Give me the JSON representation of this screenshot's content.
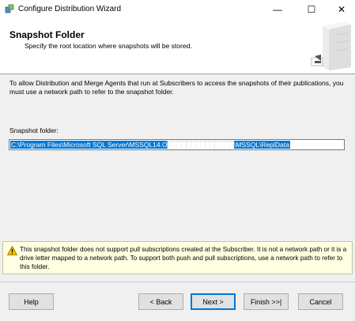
{
  "window": {
    "title": "Configure Distribution Wizard",
    "minimize": "—",
    "maximize": "☐",
    "close": "✕"
  },
  "header": {
    "title": "Snapshot Folder",
    "subtitle": "Specify the root location where snapshots will be stored."
  },
  "intro_text": "To allow Distribution and Merge Agents that run at Subscribers to access the snapshots of their publications, you must use a network path to refer to the snapshot folder.",
  "snapshot_folder": {
    "label": "Snapshot folder:",
    "value": "C:\\Program Files\\Microsoft SQL Server\\MSSQL14.O██████████████\\MSSQL\\ReplData"
  },
  "warning": {
    "icon": "warning-triangle-icon",
    "text": "This snapshot folder does not support pull subscriptions created at the Subscriber. It is not a network path or it is a drive letter mapped to a network path. To support both push and pull subscriptions, use a network path to refer to this folder."
  },
  "buttons": {
    "help": "Help",
    "back": "< Back",
    "next": "Next >",
    "finish": "Finish >>|",
    "cancel": "Cancel"
  },
  "colors": {
    "selection": "#0078d7",
    "warning_background": "#ffffe1",
    "dialog_background": "#f0f0f0"
  }
}
